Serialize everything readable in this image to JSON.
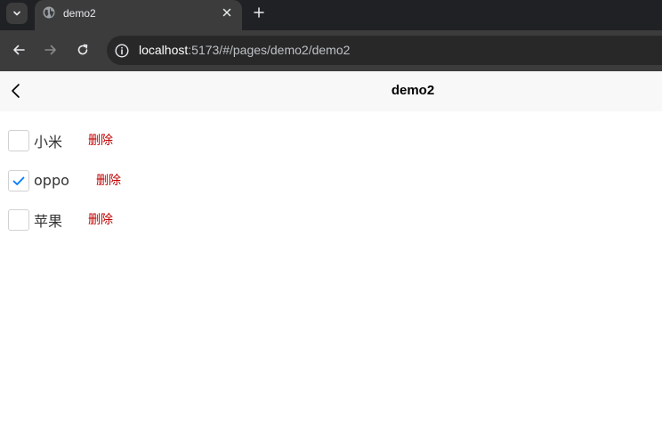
{
  "browser": {
    "tab_title": "demo2",
    "url_host": "localhost",
    "url_path": ":5173/#/pages/demo2/demo2"
  },
  "page": {
    "title": "demo2"
  },
  "items": [
    {
      "label": "小米",
      "checked": false,
      "delete_label": "删除"
    },
    {
      "label": "oppo",
      "checked": true,
      "delete_label": "删除"
    },
    {
      "label": "苹果",
      "checked": false,
      "delete_label": "删除"
    }
  ],
  "colors": {
    "checkmark": "#007aff",
    "delete": "#c00000"
  }
}
